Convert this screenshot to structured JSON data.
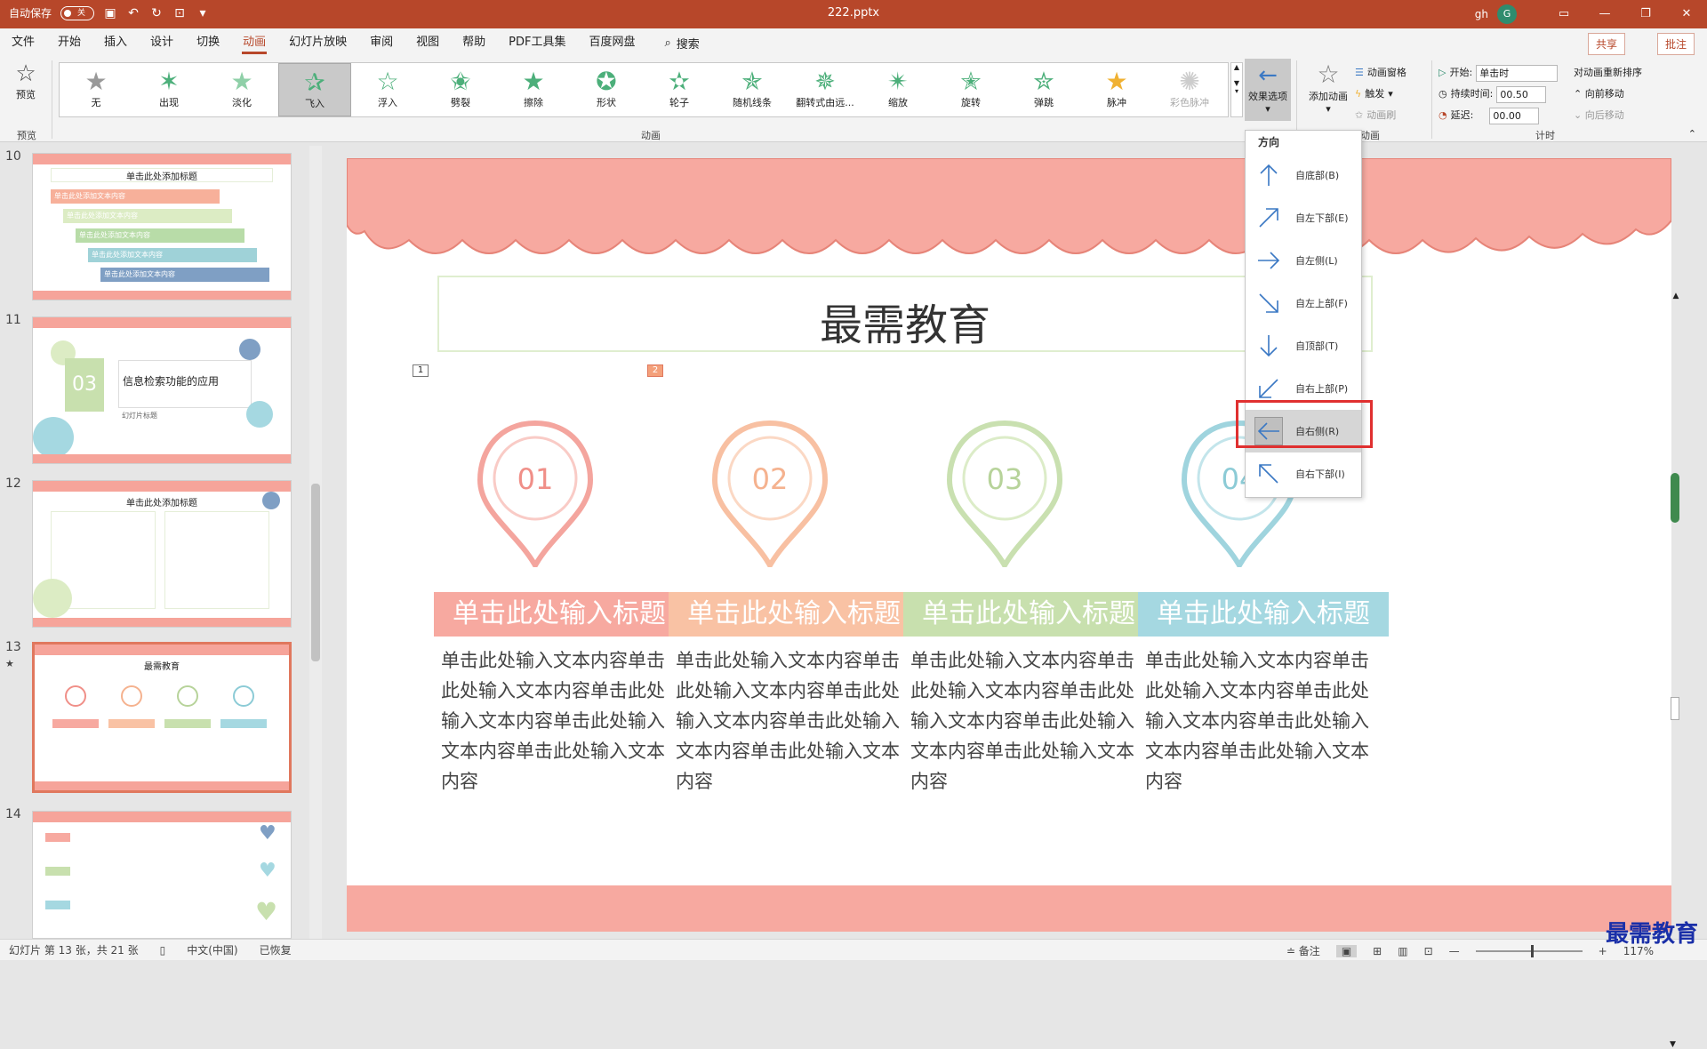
{
  "titlebar": {
    "autosave_label": "自动保存",
    "autosave_state": "关",
    "doc_title": "222.pptx",
    "user": "gh",
    "avatar_letter": "G"
  },
  "menu": {
    "items": [
      "文件",
      "开始",
      "插入",
      "设计",
      "切换",
      "动画",
      "幻灯片放映",
      "审阅",
      "视图",
      "帮助",
      "PDF工具集",
      "百度网盘"
    ],
    "active": "动画",
    "search": "搜索",
    "share": "共享",
    "comment": "批注"
  },
  "ribbon": {
    "preview_label": "预览",
    "preview_group": "预览",
    "animations_group": "动画",
    "animations": [
      {
        "label": "无",
        "icon": "star-none-icon"
      },
      {
        "label": "出现",
        "icon": "star-appear-icon"
      },
      {
        "label": "淡化",
        "icon": "star-fade-icon"
      },
      {
        "label": "飞入",
        "icon": "star-fly-in-icon"
      },
      {
        "label": "浮入",
        "icon": "star-float-icon"
      },
      {
        "label": "劈裂",
        "icon": "star-split-icon"
      },
      {
        "label": "擦除",
        "icon": "star-wipe-icon"
      },
      {
        "label": "形状",
        "icon": "star-shape-icon"
      },
      {
        "label": "轮子",
        "icon": "star-wheel-icon"
      },
      {
        "label": "随机线条",
        "icon": "star-random-bars-icon"
      },
      {
        "label": "翻转式由远...",
        "icon": "star-grow-turn-icon"
      },
      {
        "label": "缩放",
        "icon": "star-zoom-icon"
      },
      {
        "label": "旋转",
        "icon": "star-swivel-icon"
      },
      {
        "label": "弹跳",
        "icon": "star-bounce-icon"
      },
      {
        "label": "脉冲",
        "icon": "star-pulse-icon"
      },
      {
        "label": "彩色脉冲",
        "icon": "star-color-pulse-icon"
      }
    ],
    "selected_animation": "飞入",
    "effect_options": "效果选项",
    "add_animation": "添加动画",
    "advanced_group": "动画",
    "animation_pane": "动画窗格",
    "trigger": "触发",
    "animation_painter": "动画刷",
    "timing_group": "计时",
    "start_label": "开始:",
    "start_value": "单击时",
    "duration_label": "持续时间:",
    "duration_value": "00.50",
    "delay_label": "延迟:",
    "delay_value": "00.00",
    "reorder_title": "对动画重新排序",
    "move_earlier": "向前移动",
    "move_later": "向后移动"
  },
  "effect_dropdown": {
    "heading": "方向",
    "items": [
      {
        "label": "自底部(B)",
        "icon": "arrow-up-icon"
      },
      {
        "label": "自左下部(E)",
        "icon": "arrow-up-right-icon"
      },
      {
        "label": "自左侧(L)",
        "icon": "arrow-right-icon"
      },
      {
        "label": "自左上部(F)",
        "icon": "arrow-down-right-icon"
      },
      {
        "label": "自顶部(T)",
        "icon": "arrow-down-icon"
      },
      {
        "label": "自右上部(P)",
        "icon": "arrow-down-left-icon"
      },
      {
        "label": "自右侧(R)",
        "icon": "arrow-left-icon"
      },
      {
        "label": "自右下部(I)",
        "icon": "arrow-up-left-icon"
      }
    ],
    "selected": "自右侧(R)"
  },
  "thumbnails": [
    {
      "num": "10",
      "title": "单击此处添加标题",
      "rows": [
        "单击此处添加文本内容",
        "单击此处添加文本内容",
        "单击此处添加文本内容",
        "单击此处添加文本内容",
        "单击此处添加文本内容"
      ]
    },
    {
      "num": "11",
      "badge": "03",
      "text": "信息检索功能的应用",
      "sub": "幻灯片标题"
    },
    {
      "num": "12",
      "title": "单击此处添加标题"
    },
    {
      "num": "13",
      "title": "最需教育",
      "star": "★"
    },
    {
      "num": "14"
    }
  ],
  "slide": {
    "title": "最需教育",
    "tag1": "1",
    "tag2": "2",
    "items": [
      {
        "num": "01",
        "title": "单击此处输入标题",
        "body": "单击此处输入文本内容单击此处输入文本内容单击此处输入文本内容单击此处输入文本内容单击此处输入文本内容",
        "color": "#f08f88",
        "banner": "#f7a9a0"
      },
      {
        "num": "02",
        "title": "单击此处输入标题",
        "body": "单击此处输入文本内容单击此处输入文本内容单击此处输入文本内容单击此处输入文本内容单击此处输入文本内容",
        "color": "#f5b28f",
        "banner": "#f9c2a4"
      },
      {
        "num": "03",
        "title": "单击此处输入标题",
        "body": "单击此处输入文本内容单击此处输入文本内容单击此处输入文本内容单击此处输入文本内容单击此处输入文本内容",
        "color": "#b7d39a",
        "banner": "#c8e0ae"
      },
      {
        "num": "04",
        "title": "单击此处输入标题",
        "body": "单击此处输入文本内容单击此处输入文本内容单击此处输入文本内容单击此处输入文本内容单击此处输入文本内容",
        "color": "#8ccbd6",
        "banner": "#a5d8e1"
      }
    ]
  },
  "status": {
    "slide_info": "幻灯片 第 13 张，共 21 张",
    "language": "中文(中国)",
    "recovered": "已恢复",
    "notes": "备注",
    "zoom": "117%"
  },
  "watermark": "最需教育",
  "colors": {
    "accent": "#b7472a",
    "highlight": "#e03030"
  }
}
